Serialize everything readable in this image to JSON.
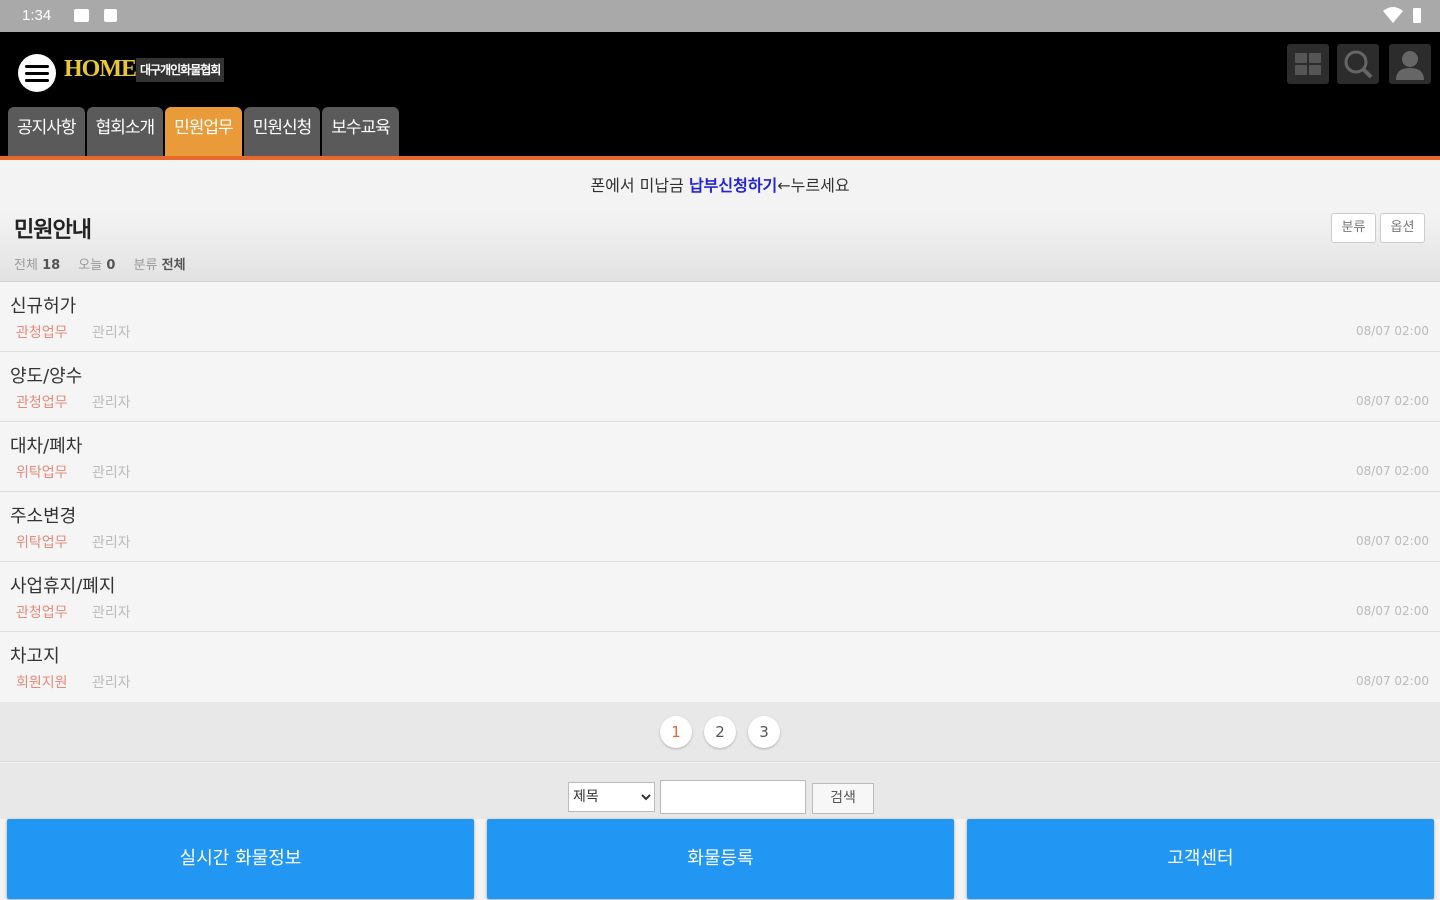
{
  "status_bar": {
    "time": "1:34"
  },
  "header": {
    "home_text": "HOME",
    "association_name": "대구개인화물협회",
    "tabs": [
      {
        "label": "공지사항",
        "active": false
      },
      {
        "label": "협회소개",
        "active": false
      },
      {
        "label": "민원업무",
        "active": true
      },
      {
        "label": "민원신청",
        "active": false
      },
      {
        "label": "보수교육",
        "active": false
      }
    ]
  },
  "notice": {
    "prefix": "폰에서 미납금 ",
    "link": "납부신청하기",
    "suffix": "←누르세요"
  },
  "board": {
    "title": "민원안내",
    "stats": {
      "total_label": "전체",
      "total_value": "18",
      "today_label": "오늘",
      "today_value": "0",
      "category_label": "분류",
      "category_value": "전체"
    },
    "buttons": {
      "category": "분류",
      "options": "옵션"
    }
  },
  "posts": [
    {
      "title": "신규허가",
      "category": "관청업무",
      "author": "관리자",
      "date": "08/07 02:00"
    },
    {
      "title": "양도/양수",
      "category": "관청업무",
      "author": "관리자",
      "date": "08/07 02:00"
    },
    {
      "title": "대차/폐차",
      "category": "위탁업무",
      "author": "관리자",
      "date": "08/07 02:00"
    },
    {
      "title": "주소변경",
      "category": "위탁업무",
      "author": "관리자",
      "date": "08/07 02:00"
    },
    {
      "title": "사업휴지/폐지",
      "category": "관청업무",
      "author": "관리자",
      "date": "08/07 02:00"
    },
    {
      "title": "차고지",
      "category": "회원지원",
      "author": "관리자",
      "date": "08/07 02:00"
    }
  ],
  "pagination": {
    "pages": [
      "1",
      "2",
      "3"
    ],
    "current": "1"
  },
  "search": {
    "field_selected": "제목",
    "query": "",
    "button": "검색"
  },
  "bottom_buttons": {
    "realtime": "실시간 화물정보",
    "register": "화물등록",
    "support": "고객센터"
  },
  "colors": {
    "accent": "#e8672a",
    "active_tab": "#e99b3a",
    "primary_button": "#2196f3",
    "notice_link": "#2323d8"
  }
}
